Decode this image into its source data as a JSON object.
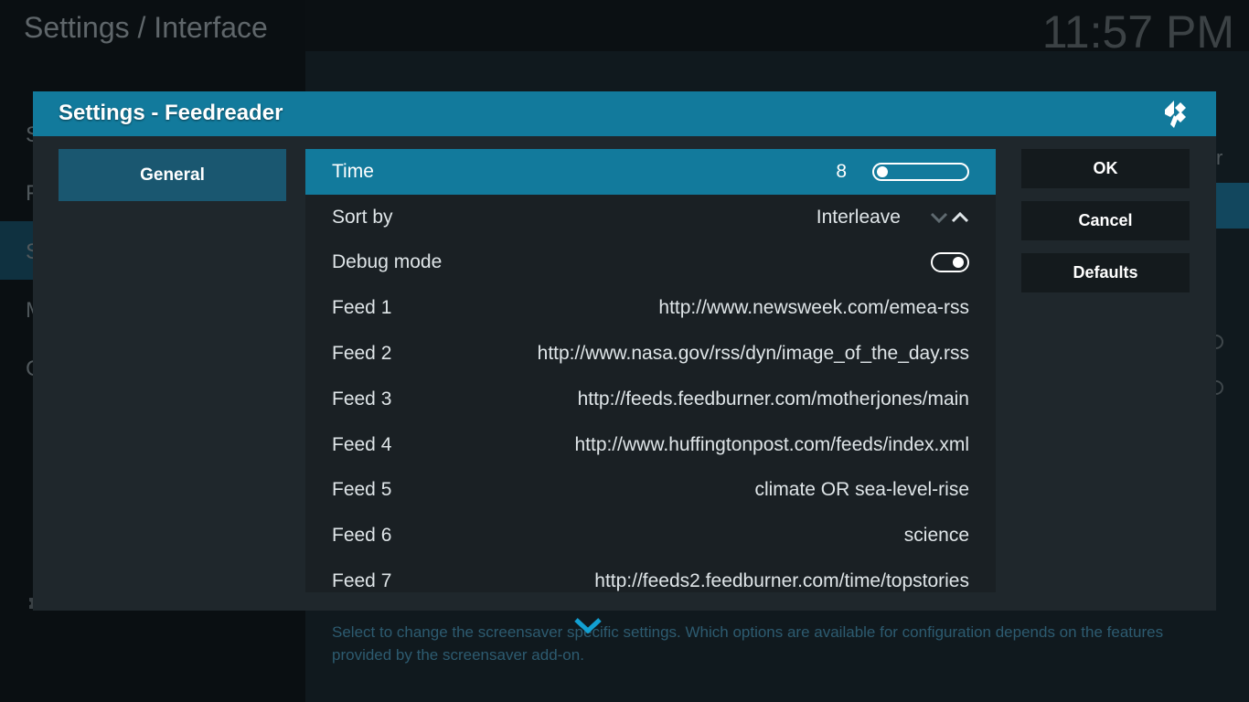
{
  "background": {
    "page_title": "Settings / Interface",
    "clock": "11:57 PM",
    "category_initials": [
      "S",
      "F",
      "S",
      "M",
      "C"
    ],
    "right_edge_letter": "r",
    "description": "Select to change the screensaver specific settings. Which options are available for configuration depends on the features provided by the screensaver add-on."
  },
  "dialog": {
    "title": "Settings - Feedreader",
    "logo_icon": "kodi-logo-icon",
    "category": "General",
    "buttons": {
      "ok": "OK",
      "cancel": "Cancel",
      "defaults": "Defaults"
    },
    "settings": {
      "time": {
        "label": "Time",
        "value": "8",
        "slider_fraction": 0.0
      },
      "sort_by": {
        "label": "Sort by",
        "value": "Interleave"
      },
      "debug_mode": {
        "label": "Debug mode",
        "enabled": true
      },
      "feeds": [
        {
          "label": "Feed 1",
          "value": "http://www.newsweek.com/emea-rss"
        },
        {
          "label": "Feed 2",
          "value": "http://www.nasa.gov/rss/dyn/image_of_the_day.rss"
        },
        {
          "label": "Feed 3",
          "value": "http://feeds.feedburner.com/motherjones/main"
        },
        {
          "label": "Feed 4",
          "value": "http://www.huffingtonpost.com/feeds/index.xml"
        },
        {
          "label": "Feed 5",
          "value": "climate OR sea-level-rise"
        },
        {
          "label": "Feed 6",
          "value": "science"
        },
        {
          "label": "Feed 7",
          "value": "http://feeds2.feedburner.com/time/topstories"
        }
      ]
    }
  },
  "colors": {
    "accent": "#127a9c",
    "dialog_bg": "#1f272c",
    "category_selected": "#1a5770",
    "scroll_arrow": "#12a0d2"
  }
}
